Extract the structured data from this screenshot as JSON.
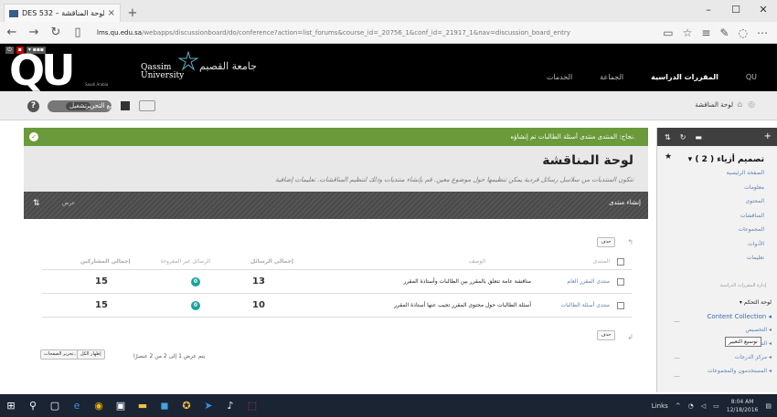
{
  "browser": {
    "tab_title": "DES 532 – لوحة المناقشة",
    "tab_close": "×",
    "new_tab": "+",
    "url_domain": "lms.qu.edu.sa",
    "url_path": "/webapps/discussionboard/do/conference?action=list_forums&course_id=_20756_1&conf_id=_21917_1&nav=discussion_board_entry",
    "win_min": "–",
    "win_max": "☐",
    "win_close": "✕",
    "back": "←",
    "forward": "→",
    "refresh": "↻",
    "icons": [
      "reading-view-icon",
      "favorite-star-icon",
      "hub-icon",
      "notes-icon",
      "share-icon",
      "more-icon"
    ]
  },
  "header": {
    "logo_text": "QU",
    "logo_sub": "Saudi Arabia",
    "uni_name_en_1": "Qassim",
    "uni_name_en_2": "University",
    "uni_name_ar": "جامعة القصيم",
    "nav": [
      "QU",
      "المقررات الدراسية",
      "الجماعة",
      "الخدمات"
    ],
    "active_nav": "المقررات الدراسية"
  },
  "subheader": {
    "breadcrumb": "لوحة المناقشة",
    "edit_mode_label": "وضع التحرير",
    "edit_mode_state": "تشغيل",
    "help": "?"
  },
  "main": {
    "success_message": "نجاح: المنتدى منتدى أسئلة الطالبات تم إنشاؤه.",
    "page_title": "لوحة المناقشة",
    "page_description": "تتكون المنتديات من سلاسل رسائل فردية يمكن تنظيمها حول موضوع معين. قم بإنشاء منتديات وذلك لتنظيم المناقشات. تعليمات إضافية",
    "create_forum": "إنشاء منتدى",
    "view_label": "عرض",
    "delete_label": "حذف",
    "columns": {
      "forum": "المنتدى",
      "description": "الوصف",
      "total_posts": "إجمالي الرسائل",
      "unread_posts": "الرسائل غير المقروءة",
      "total_participants": "إجمالي المشاركين"
    },
    "rows": [
      {
        "forum": "منتدى المقرر العام",
        "description": "مناقشة عامة تتعلق بالمقرر بين الطالبات وأستاذة المقرر",
        "total": "13",
        "unread": "0",
        "participants": "15"
      },
      {
        "forum": "منتدى أسئلة الطالبات",
        "description": "أسئلة الطالبات حول محتوى المقرر تجيب عنها أستاذة المقرر",
        "total": "10",
        "unread": "0",
        "participants": "15"
      }
    ],
    "pager_info": "يتم عرض 1 إلى 2 من 2 عنصرًا",
    "show_all": "إظهار الكل",
    "edit_paging": "تحرير الصفحات..."
  },
  "sidebar": {
    "course_title": "تصميم أزياء ( 2 )",
    "menu": [
      "الصفحة الرئيسية",
      "معلومات",
      "المحتوى",
      "المناقشات",
      "المجموعات",
      "الأدوات",
      "تعليمات"
    ],
    "management_label": "إدارة المقررات الدراسية",
    "management": [
      "لوحة التحكم",
      "Content Collection",
      "التخصيص",
      "النتائج",
      "مركز الدرجات",
      "المستخدمون والمجموعات"
    ],
    "tooltip": "توسيع التعبير"
  },
  "taskbar": {
    "links_label": "Links",
    "time": "8:04 AM",
    "date": "12/18/2016"
  },
  "colors": {
    "success_green": "#6a9a3a",
    "badge_teal": "#1ba39c",
    "link_blue": "#5b7fb0"
  }
}
